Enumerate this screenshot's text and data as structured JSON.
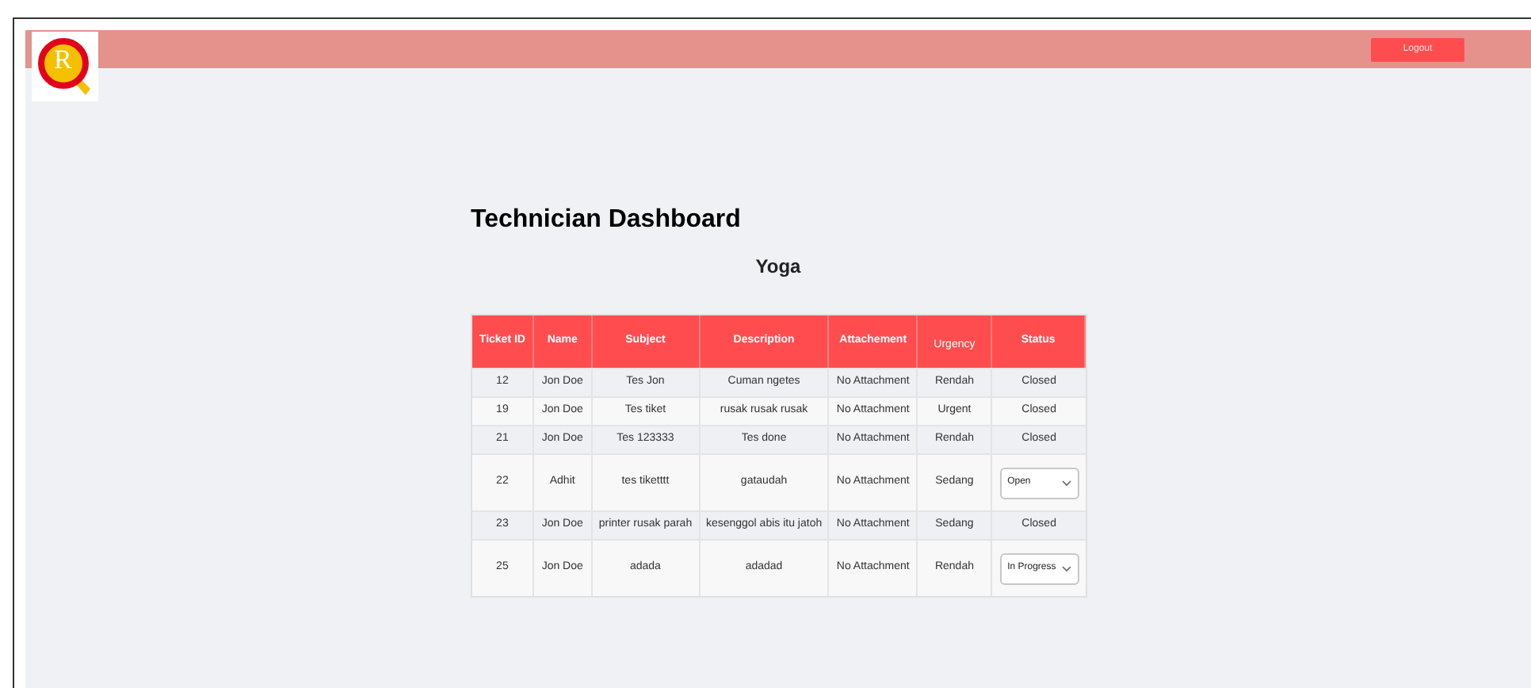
{
  "logo": {
    "letter": "R"
  },
  "header": {
    "logout_button": "Logout"
  },
  "title": "Technician Dashboard",
  "user_name": "Yoga",
  "table": {
    "columns": [
      "Ticket ID",
      "Name",
      "Subject",
      "Description",
      "Attachement",
      "Urgency",
      "Status"
    ],
    "rows": [
      {
        "ticket_id": "12",
        "name": "Jon Doe",
        "subject": "Tes Jon",
        "description": "Cuman ngetes",
        "attachment": "No Attachment",
        "urgency": "Rendah",
        "status": {
          "kind": "text",
          "value": "Closed"
        }
      },
      {
        "ticket_id": "19",
        "name": "Jon Doe",
        "subject": "Tes tiket",
        "description": "rusak rusak rusak",
        "attachment": "No Attachment",
        "urgency": "Urgent",
        "status": {
          "kind": "text",
          "value": "Closed"
        }
      },
      {
        "ticket_id": "21",
        "name": "Jon Doe",
        "subject": "Tes 123333",
        "description": "Tes done",
        "attachment": "No Attachment",
        "urgency": "Rendah",
        "status": {
          "kind": "text",
          "value": "Closed"
        }
      },
      {
        "ticket_id": "22",
        "name": "Adhit",
        "subject": "tes tiketttt",
        "description": "gataudah",
        "attachment": "No Attachment",
        "urgency": "Sedang",
        "status": {
          "kind": "select",
          "value": "Open"
        }
      },
      {
        "ticket_id": "23",
        "name": "Jon Doe",
        "subject": "printer rusak parah",
        "description": "kesenggol abis itu jatoh",
        "attachment": "No Attachment",
        "urgency": "Sedang",
        "status": {
          "kind": "text",
          "value": "Closed"
        }
      },
      {
        "ticket_id": "25",
        "name": "Jon Doe",
        "subject": "adada",
        "description": "adadad",
        "attachment": "No Attachment",
        "urgency": "Rendah",
        "status": {
          "kind": "select",
          "value": "In Progress"
        }
      }
    ]
  }
}
